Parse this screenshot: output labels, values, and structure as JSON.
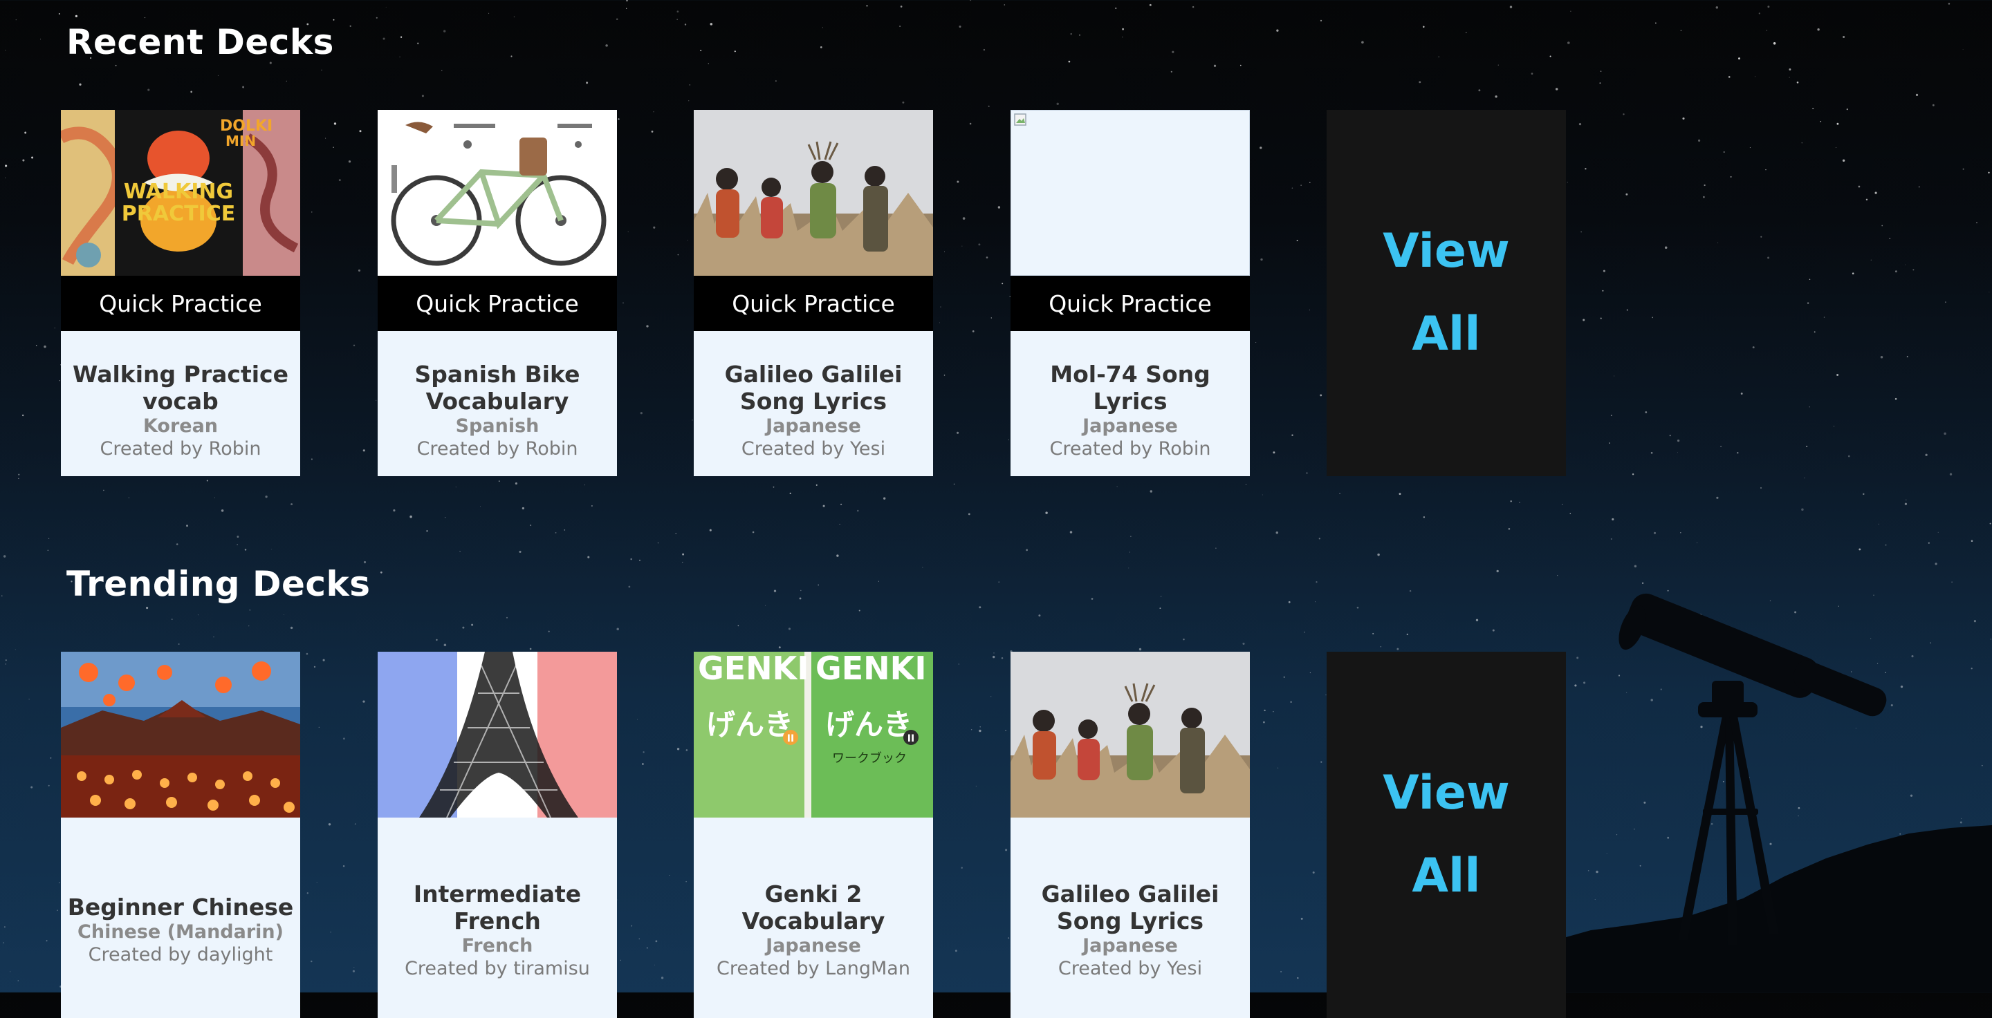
{
  "sections": {
    "recent": {
      "title": "Recent Decks",
      "decks": [
        {
          "name": "Walking Practice vocab",
          "language": "Korean",
          "creator": "Created by Robin",
          "action": "Quick Practice",
          "image_icon": "book-cover-image"
        },
        {
          "name": "Spanish Bike Vocabulary",
          "language": "Spanish",
          "creator": "Created by Robin",
          "action": "Quick Practice",
          "image_icon": "bicycle-parts-image"
        },
        {
          "name": "Galileo Galilei Song Lyrics",
          "language": "Japanese",
          "creator": "Created by Yesi",
          "action": "Quick Practice",
          "image_icon": "band-photo-image"
        },
        {
          "name": "Mol-74 Song Lyrics",
          "language": "Japanese",
          "creator": "Created by Robin",
          "action": "Quick Practice",
          "image_icon": "broken-image"
        }
      ],
      "view_all": {
        "line1": "View",
        "line2": "All"
      }
    },
    "trending": {
      "title": "Trending Decks",
      "decks": [
        {
          "name": "Beginner Chinese",
          "language": "Chinese (Mandarin)",
          "creator": "Created by daylight",
          "image_icon": "lanterns-image"
        },
        {
          "name": "Intermediate French",
          "language": "French",
          "creator": "Created by tiramisu",
          "image_icon": "eiffel-tower-image"
        },
        {
          "name": "Genki 2 Vocabulary",
          "language": "Japanese",
          "creator": "Created by LangMan",
          "image_icon": "genki-books-image"
        },
        {
          "name": "Galileo Galilei Song Lyrics",
          "language": "Japanese",
          "creator": "Created by Yesi",
          "image_icon": "band-photo-image"
        }
      ],
      "view_all": {
        "line1": "View",
        "line2": "All"
      }
    },
    "genki_cover": {
      "brand": "GENKI",
      "kana": "げんき",
      "volume": "II",
      "workbook": "ワークブック"
    }
  },
  "colors": {
    "accent": "#3cc3f2",
    "card_bg": "#edf5fd",
    "title_text": "#333333",
    "language_text": "#8a8a8a",
    "view_all_bg": "#151515",
    "genki_green": "#6cbd57"
  }
}
